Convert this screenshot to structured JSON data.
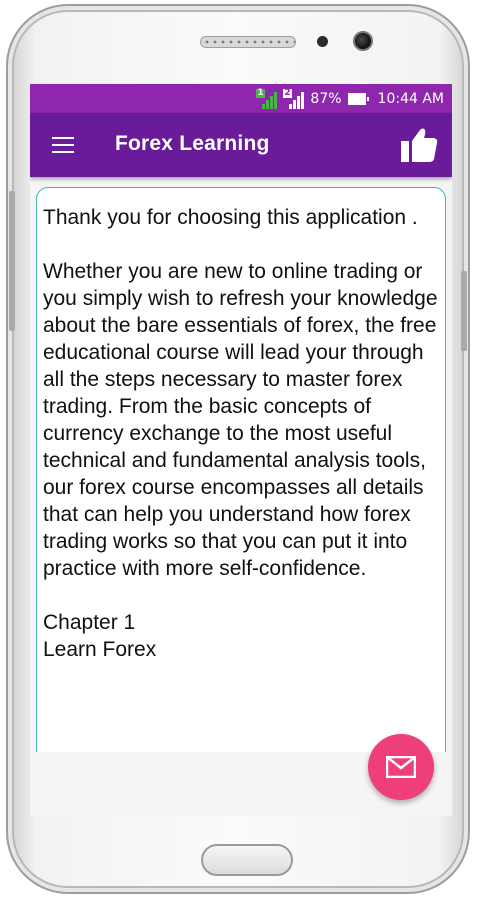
{
  "status_bar": {
    "sim1": "1",
    "sim2": "2",
    "battery_percent": "87%",
    "time": "10:44 AM"
  },
  "app_bar": {
    "title": "Forex Learning",
    "menu_icon": "hamburger-menu-icon",
    "action_icon": "thumbs-up-icon"
  },
  "content": {
    "text": "Thank you for choosing this application .\n\nWhether you are new to online trading or you simply wish to refresh your knowledge about the bare essentials of forex, the free educational course will lead your through all the steps necessary to master forex trading. From the basic concepts of currency exchange to the most useful technical and fundamental analysis tools, our forex course encompasses all details that can help you understand how forex trading works so that you can put it into practice with more self-confidence.\n\nChapter 1\nLearn Forex"
  },
  "fab": {
    "icon": "mail-icon"
  },
  "colors": {
    "status_bar": "#8e27ad",
    "app_bar": "#6a1b9a",
    "card_border": "#3fb6a8",
    "fab": "#ef3e7c"
  }
}
